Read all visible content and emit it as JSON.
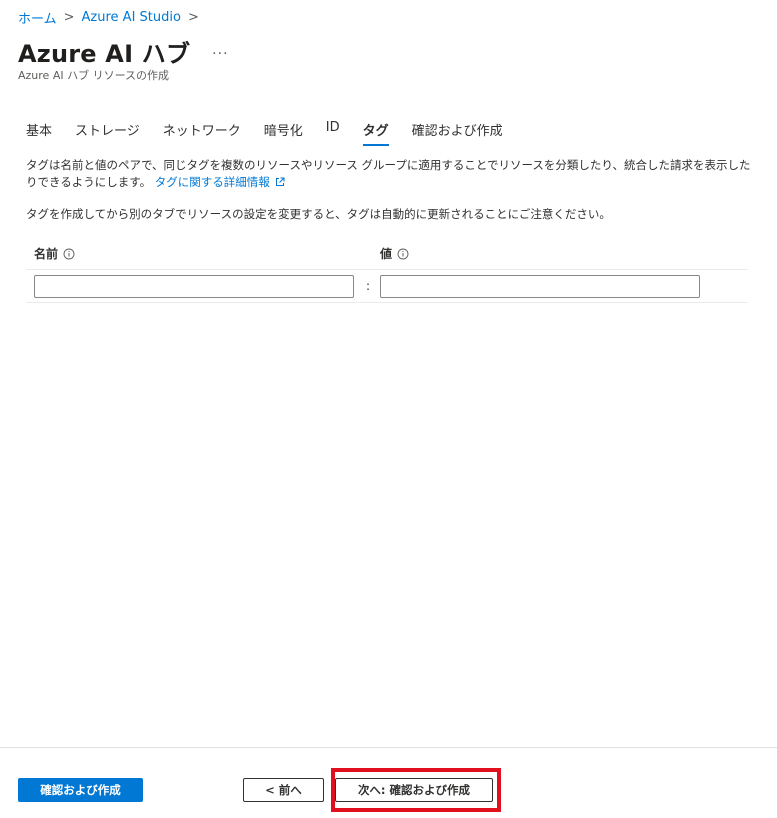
{
  "breadcrumb": {
    "items": [
      "ホーム",
      "Azure AI Studio"
    ],
    "separator": ">"
  },
  "header": {
    "title": "Azure AI ハブ",
    "more": "···",
    "subtitle": "Azure AI ハブ リソースの作成"
  },
  "tabs": [
    {
      "label": "基本",
      "active": false
    },
    {
      "label": "ストレージ",
      "active": false
    },
    {
      "label": "ネットワーク",
      "active": false
    },
    {
      "label": "暗号化",
      "active": false
    },
    {
      "label": "ID",
      "active": false
    },
    {
      "label": "タグ",
      "active": true
    },
    {
      "label": "確認および作成",
      "active": false
    }
  ],
  "description": {
    "text": "タグは名前と値のペアで、同じタグを複数のリソースやリソース グループに適用することでリソースを分類したり、統合した請求を表示したりできるようにします。",
    "link": "タグに関する詳細情報"
  },
  "note": "タグを作成してから別のタブでリソースの設定を変更すると、タグは自動的に更新されることにご注意ください。",
  "table": {
    "name_header": "名前",
    "value_header": "値",
    "separator": ":",
    "rows": [
      {
        "name": "",
        "value": ""
      }
    ]
  },
  "footer": {
    "review_create": "確認および作成",
    "prev": "< 前へ",
    "next": "次へ: 確認および作成"
  },
  "colors": {
    "accent": "#0078d4",
    "highlight": "#e0101e"
  }
}
